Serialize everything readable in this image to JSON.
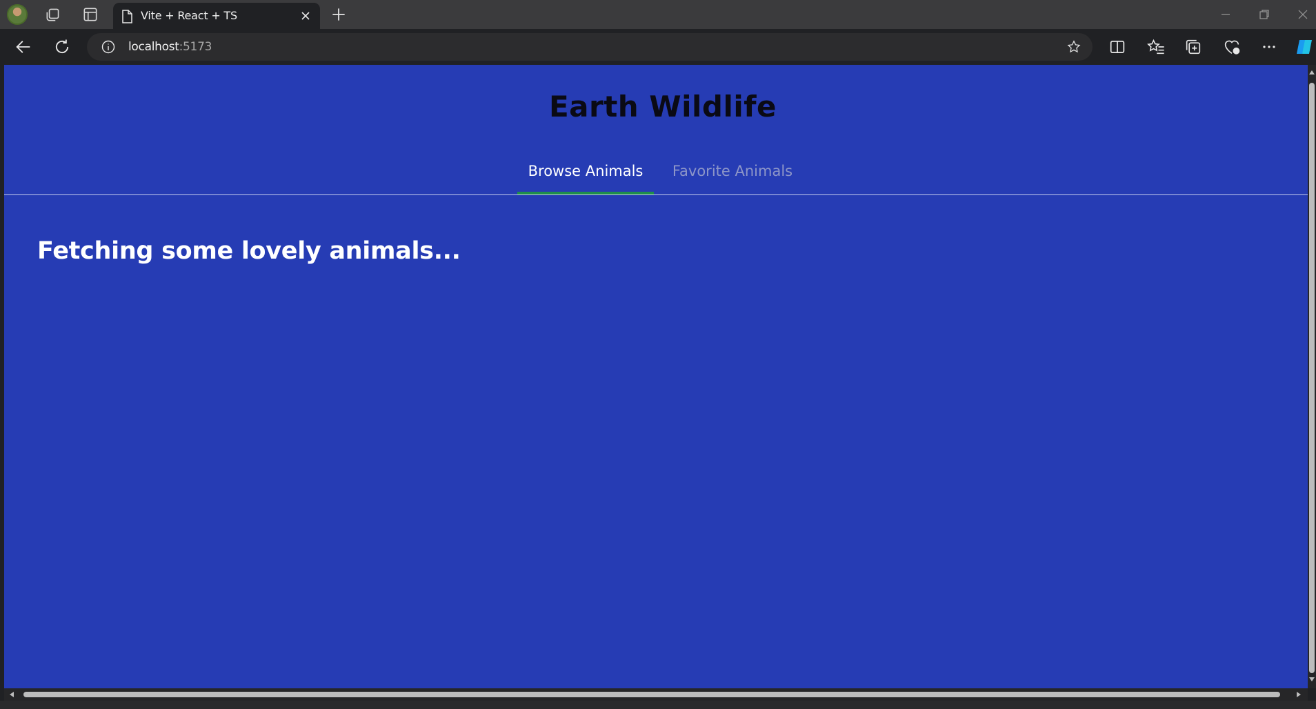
{
  "browser": {
    "tab": {
      "title": "Vite + React + TS",
      "icon": "document-icon"
    },
    "address_bar": {
      "host": "localhost",
      "port": ":5173"
    }
  },
  "app": {
    "title": "Earth Wildlife",
    "nav_tabs": [
      {
        "label": "Browse Animals",
        "active": true
      },
      {
        "label": "Favorite Animals",
        "active": false
      }
    ],
    "status_message": "Fetching some lovely animals..."
  },
  "colors": {
    "page_background": "#263cb4",
    "active_tab_indicator": "#1f8f4a",
    "inactive_tab_text": "#8d96c8"
  }
}
